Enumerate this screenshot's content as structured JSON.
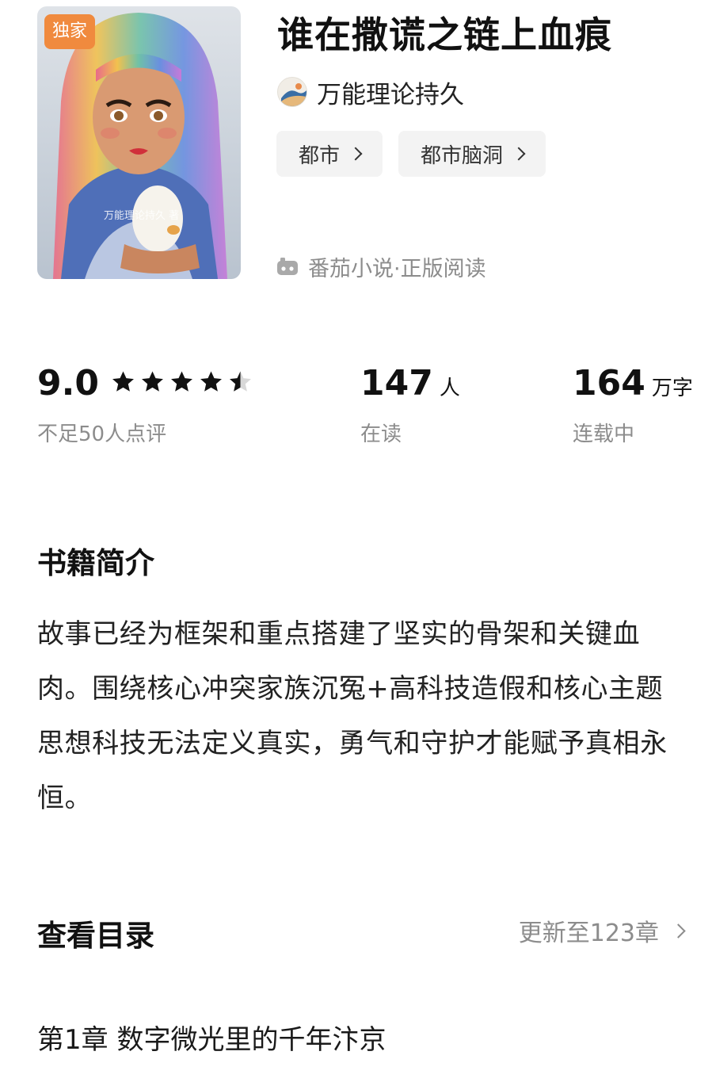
{
  "book": {
    "badge": "独家",
    "cover_watermark": "万能理论持久 著",
    "title": "谁在撒谎之链上血痕",
    "author": "万能理论持久",
    "tags": [
      "都市",
      "都市脑洞"
    ],
    "source": "番茄小说·正版阅读"
  },
  "stats": {
    "rating": {
      "value": "9.0",
      "label": "不足50人点评",
      "stars": 4.5
    },
    "readers": {
      "value": "147",
      "unit": "人",
      "label": "在读"
    },
    "words": {
      "value": "164",
      "unit": "万字",
      "label": "连载中"
    }
  },
  "intro": {
    "title": "书籍简介",
    "text": "故事已经为框架和重点搭建了坚实的骨架和关键血肉。围绕核心冲突家族沉冤+高科技造假和核心主题思想科技无法定义真实，勇气和守护才能赋予真相永恒。"
  },
  "catalog": {
    "title": "查看目录",
    "update_text": "更新至123章",
    "first_chapter": "第1章 数字微光里的千年汴京"
  },
  "colors": {
    "badge": "#f08a3e",
    "tag_bg": "#f3f3f3",
    "muted": "#8c8c8c",
    "star": "#111111"
  }
}
